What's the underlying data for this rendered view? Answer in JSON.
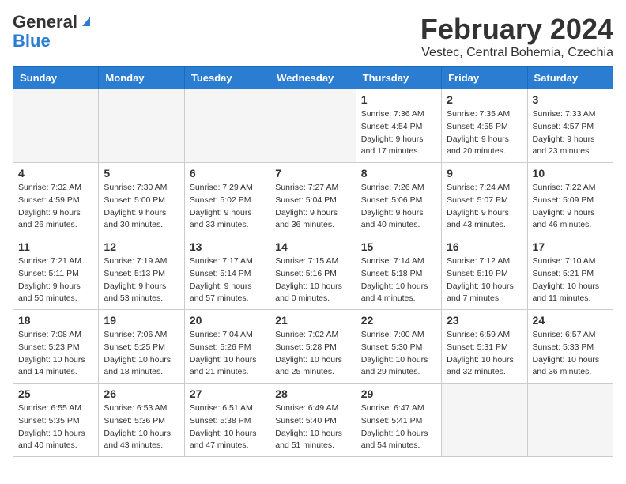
{
  "logo": {
    "line1": "General",
    "line2": "Blue"
  },
  "title": "February 2024",
  "subtitle": "Vestec, Central Bohemia, Czechia",
  "weekdays": [
    "Sunday",
    "Monday",
    "Tuesday",
    "Wednesday",
    "Thursday",
    "Friday",
    "Saturday"
  ],
  "weeks": [
    [
      {
        "day": "",
        "info": ""
      },
      {
        "day": "",
        "info": ""
      },
      {
        "day": "",
        "info": ""
      },
      {
        "day": "",
        "info": ""
      },
      {
        "day": "1",
        "info": "Sunrise: 7:36 AM\nSunset: 4:54 PM\nDaylight: 9 hours\nand 17 minutes."
      },
      {
        "day": "2",
        "info": "Sunrise: 7:35 AM\nSunset: 4:55 PM\nDaylight: 9 hours\nand 20 minutes."
      },
      {
        "day": "3",
        "info": "Sunrise: 7:33 AM\nSunset: 4:57 PM\nDaylight: 9 hours\nand 23 minutes."
      }
    ],
    [
      {
        "day": "4",
        "info": "Sunrise: 7:32 AM\nSunset: 4:59 PM\nDaylight: 9 hours\nand 26 minutes."
      },
      {
        "day": "5",
        "info": "Sunrise: 7:30 AM\nSunset: 5:00 PM\nDaylight: 9 hours\nand 30 minutes."
      },
      {
        "day": "6",
        "info": "Sunrise: 7:29 AM\nSunset: 5:02 PM\nDaylight: 9 hours\nand 33 minutes."
      },
      {
        "day": "7",
        "info": "Sunrise: 7:27 AM\nSunset: 5:04 PM\nDaylight: 9 hours\nand 36 minutes."
      },
      {
        "day": "8",
        "info": "Sunrise: 7:26 AM\nSunset: 5:06 PM\nDaylight: 9 hours\nand 40 minutes."
      },
      {
        "day": "9",
        "info": "Sunrise: 7:24 AM\nSunset: 5:07 PM\nDaylight: 9 hours\nand 43 minutes."
      },
      {
        "day": "10",
        "info": "Sunrise: 7:22 AM\nSunset: 5:09 PM\nDaylight: 9 hours\nand 46 minutes."
      }
    ],
    [
      {
        "day": "11",
        "info": "Sunrise: 7:21 AM\nSunset: 5:11 PM\nDaylight: 9 hours\nand 50 minutes."
      },
      {
        "day": "12",
        "info": "Sunrise: 7:19 AM\nSunset: 5:13 PM\nDaylight: 9 hours\nand 53 minutes."
      },
      {
        "day": "13",
        "info": "Sunrise: 7:17 AM\nSunset: 5:14 PM\nDaylight: 9 hours\nand 57 minutes."
      },
      {
        "day": "14",
        "info": "Sunrise: 7:15 AM\nSunset: 5:16 PM\nDaylight: 10 hours\nand 0 minutes."
      },
      {
        "day": "15",
        "info": "Sunrise: 7:14 AM\nSunset: 5:18 PM\nDaylight: 10 hours\nand 4 minutes."
      },
      {
        "day": "16",
        "info": "Sunrise: 7:12 AM\nSunset: 5:19 PM\nDaylight: 10 hours\nand 7 minutes."
      },
      {
        "day": "17",
        "info": "Sunrise: 7:10 AM\nSunset: 5:21 PM\nDaylight: 10 hours\nand 11 minutes."
      }
    ],
    [
      {
        "day": "18",
        "info": "Sunrise: 7:08 AM\nSunset: 5:23 PM\nDaylight: 10 hours\nand 14 minutes."
      },
      {
        "day": "19",
        "info": "Sunrise: 7:06 AM\nSunset: 5:25 PM\nDaylight: 10 hours\nand 18 minutes."
      },
      {
        "day": "20",
        "info": "Sunrise: 7:04 AM\nSunset: 5:26 PM\nDaylight: 10 hours\nand 21 minutes."
      },
      {
        "day": "21",
        "info": "Sunrise: 7:02 AM\nSunset: 5:28 PM\nDaylight: 10 hours\nand 25 minutes."
      },
      {
        "day": "22",
        "info": "Sunrise: 7:00 AM\nSunset: 5:30 PM\nDaylight: 10 hours\nand 29 minutes."
      },
      {
        "day": "23",
        "info": "Sunrise: 6:59 AM\nSunset: 5:31 PM\nDaylight: 10 hours\nand 32 minutes."
      },
      {
        "day": "24",
        "info": "Sunrise: 6:57 AM\nSunset: 5:33 PM\nDaylight: 10 hours\nand 36 minutes."
      }
    ],
    [
      {
        "day": "25",
        "info": "Sunrise: 6:55 AM\nSunset: 5:35 PM\nDaylight: 10 hours\nand 40 minutes."
      },
      {
        "day": "26",
        "info": "Sunrise: 6:53 AM\nSunset: 5:36 PM\nDaylight: 10 hours\nand 43 minutes."
      },
      {
        "day": "27",
        "info": "Sunrise: 6:51 AM\nSunset: 5:38 PM\nDaylight: 10 hours\nand 47 minutes."
      },
      {
        "day": "28",
        "info": "Sunrise: 6:49 AM\nSunset: 5:40 PM\nDaylight: 10 hours\nand 51 minutes."
      },
      {
        "day": "29",
        "info": "Sunrise: 6:47 AM\nSunset: 5:41 PM\nDaylight: 10 hours\nand 54 minutes."
      },
      {
        "day": "",
        "info": ""
      },
      {
        "day": "",
        "info": ""
      }
    ]
  ]
}
